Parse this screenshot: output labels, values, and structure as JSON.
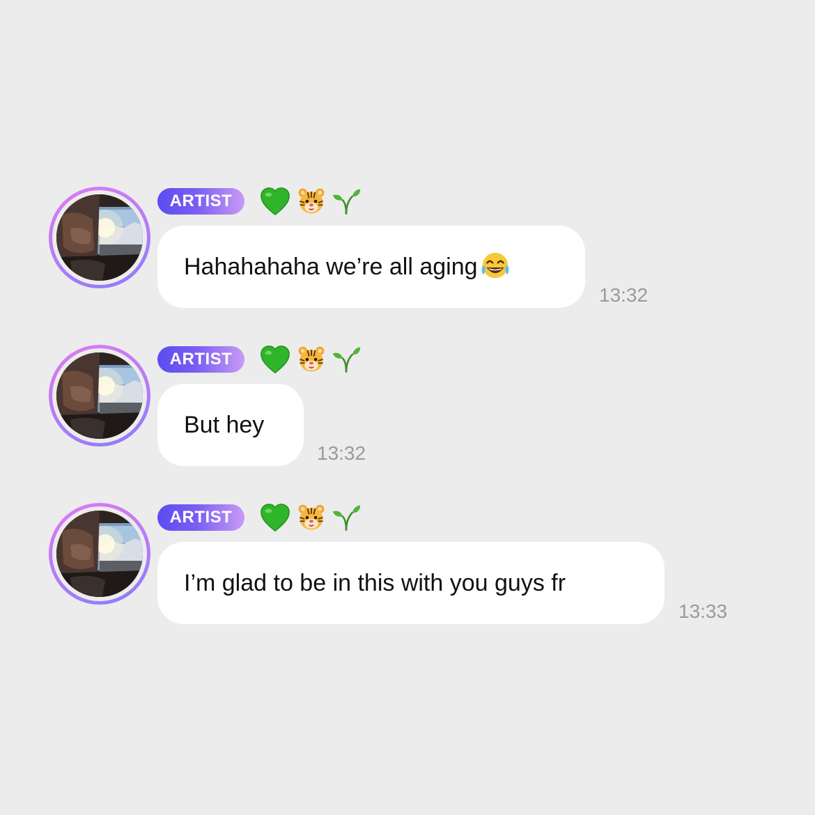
{
  "messages": [
    {
      "badge": "ARTIST",
      "text": "Hahahahaha we’re all aging",
      "trailing_emoji": "face-with-tears-of-joy-icon",
      "time": "13:32"
    },
    {
      "badge": "ARTIST",
      "text": "But hey",
      "time": "13:32"
    },
    {
      "badge": "ARTIST",
      "text": "I’m glad to be in this with you guys fr",
      "time": "13:33"
    }
  ],
  "name_emojis": [
    "green-heart-icon",
    "tiger-face-icon",
    "seedling-icon"
  ],
  "colors": {
    "background": "#ececec",
    "bubble": "#ffffff",
    "badge_start": "#5a4df0",
    "badge_end": "#c99af5",
    "timestamp": "#9a9a9a"
  }
}
